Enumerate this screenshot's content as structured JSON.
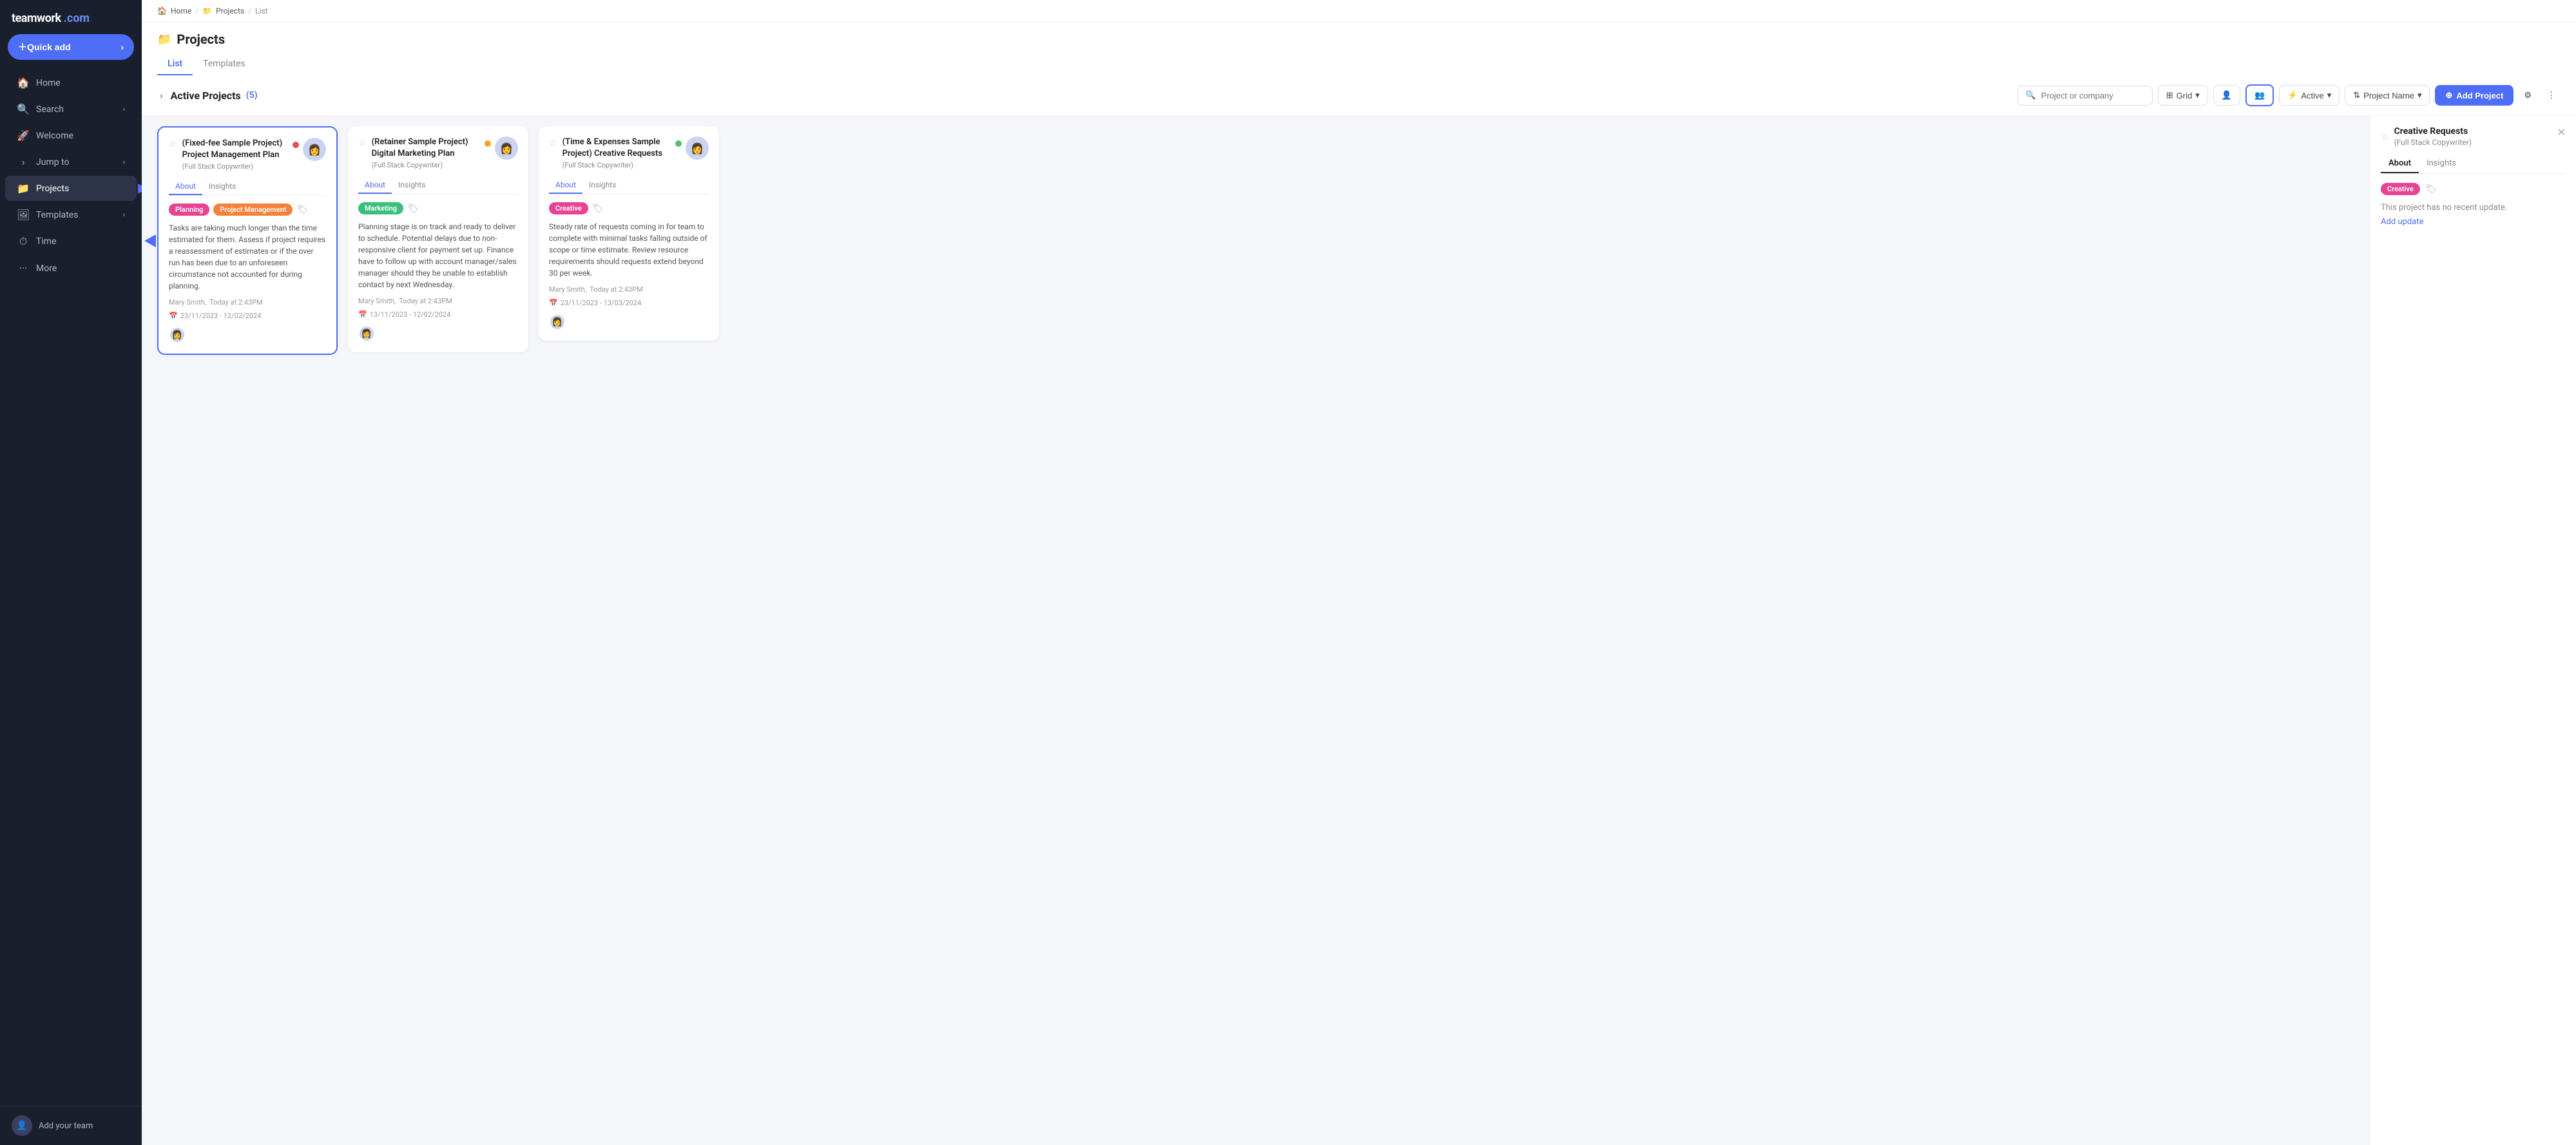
{
  "sidebar": {
    "logo": "teamwork",
    "logo_suffix": ".com",
    "quick_add_label": "Quick add",
    "nav_items": [
      {
        "id": "home",
        "icon": "🏠",
        "label": "Home",
        "has_chevron": false
      },
      {
        "id": "search",
        "icon": "🔍",
        "label": "Search",
        "has_chevron": true
      },
      {
        "id": "welcome",
        "icon": "🚀",
        "label": "Welcome",
        "has_chevron": false
      },
      {
        "id": "jump-to",
        "icon": "›",
        "label": "Jump to",
        "has_chevron": true,
        "prefix_arrow": true
      },
      {
        "id": "projects",
        "icon": "📁",
        "label": "Projects",
        "has_chevron": false,
        "active": true
      },
      {
        "id": "templates",
        "icon": "🖼",
        "label": "Templates",
        "has_chevron": true
      },
      {
        "id": "time",
        "icon": "⏱",
        "label": "Time",
        "has_chevron": false
      },
      {
        "id": "more",
        "icon": "···",
        "label": "More",
        "has_chevron": false
      }
    ],
    "add_team_label": "Add your team"
  },
  "breadcrumb": {
    "items": [
      "Home",
      "Projects",
      "List"
    ]
  },
  "page": {
    "title": "Projects",
    "title_icon": "📁",
    "tabs": [
      {
        "id": "list",
        "label": "List",
        "active": true
      },
      {
        "id": "templates",
        "label": "Templates",
        "active": false
      }
    ]
  },
  "toolbar": {
    "section_title": "Active Projects",
    "project_count": "(5)",
    "search_placeholder": "Project or company",
    "grid_label": "Grid",
    "active_label": "Active",
    "sort_label": "Project Name",
    "add_project_label": "Add Project",
    "filter_icon": "filter",
    "more_icon": "more"
  },
  "projects": [
    {
      "id": "project-1",
      "starred": false,
      "title": "(Fixed-fee Sample Project) Project Management Plan",
      "subtitle": "(Full Stack Copywriter)",
      "status_color": "red",
      "active_tab": "About",
      "tabs": [
        "About",
        "Insights"
      ],
      "tags": [
        {
          "label": "Planning",
          "color": "pink"
        },
        {
          "label": "Project Management",
          "color": "orange"
        }
      ],
      "description": "Tasks are taking much longer than the time estimated for them. Assess if project requires a reassessment of estimates or if the over run has been due to an unforeseen circumstance not accounted for during planning.",
      "author": "Mary Smith",
      "updated": "Today at 2:43PM",
      "date_range": "23/11/2023 - 12/02/2024",
      "has_blue_arrow": true
    },
    {
      "id": "project-2",
      "starred": false,
      "title": "(Retainer Sample Project) Digital Marketing Plan",
      "subtitle": "(Full Stack Copywriter)",
      "status_color": "yellow",
      "active_tab": "About",
      "tabs": [
        "About",
        "Insights"
      ],
      "tags": [
        {
          "label": "Marketing",
          "color": "green"
        }
      ],
      "description": "Planning stage is on track and ready to deliver to schedule. Potential delays due to non-responsive client for payment set up. Finance have to follow up with account manager/sales manager should they be unable to establish contact by next Wednesday.",
      "author": "Mary Smith",
      "updated": "Today at 2:43PM",
      "date_range": "13/11/2023 - 12/02/2024",
      "has_blue_arrow": false
    },
    {
      "id": "project-3",
      "starred": false,
      "title": "(Time & Expenses Sample Project) Creative Requests",
      "subtitle": "(Full Stack Copywriter)",
      "status_color": "green",
      "active_tab": "About",
      "tabs": [
        "About",
        "Insights"
      ],
      "tags": [
        {
          "label": "Creative",
          "color": "pink"
        }
      ],
      "description": "Steady rate of requests coming in for team to complete with minimal tasks falling outside of scope or time estimate. Review resource requirements should requests extend beyond 30 per week.",
      "author": "Mary Smith",
      "updated": "Today at 2:43PM",
      "date_range": "23/11/2023 - 13/03/2024",
      "has_blue_arrow": false
    }
  ],
  "right_panel": {
    "title": "Creative Requests",
    "subtitle": "(Full Stack Copywriter)",
    "tabs": [
      "About",
      "Insights"
    ],
    "active_tab": "About",
    "tags": [
      {
        "label": "Creative",
        "color": "pink"
      }
    ],
    "no_update_text": "This project has no recent update.",
    "add_update_label": "Add update"
  },
  "colors": {
    "primary": "#4f6ef7",
    "sidebar_bg": "#1a1f2e",
    "card_bg": "#ffffff"
  }
}
